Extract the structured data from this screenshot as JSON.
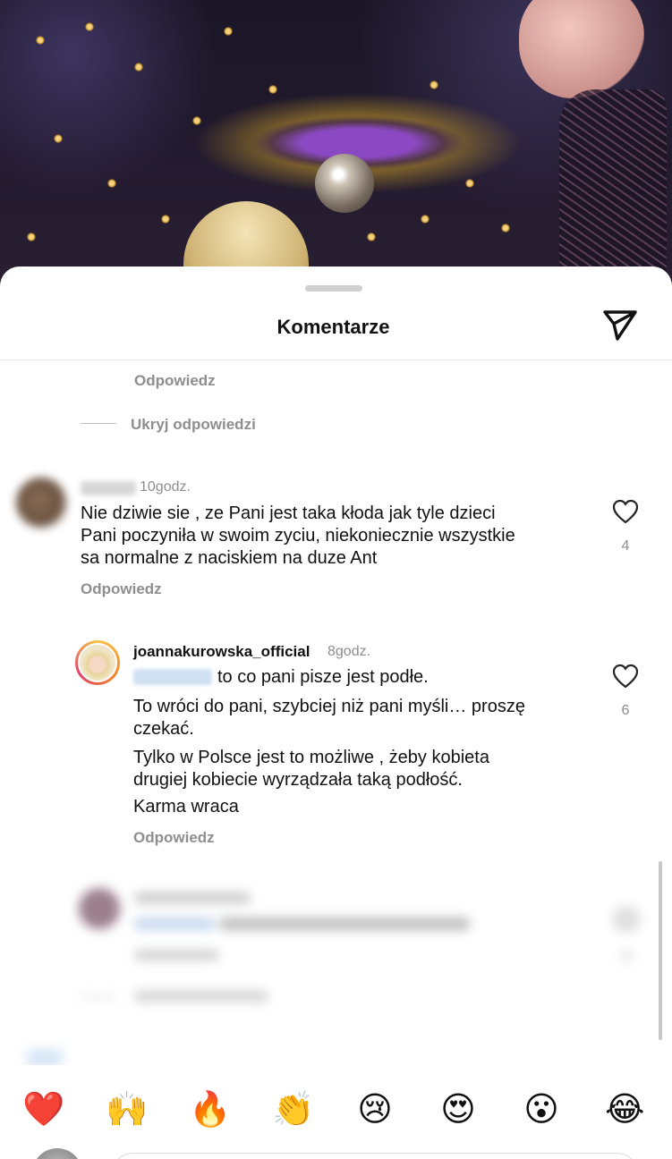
{
  "sheet": {
    "title": "Komentarze"
  },
  "thread_top": {
    "reply_label": "Odpowiedz",
    "hide_replies_label": "Ukryj odpowiedzi"
  },
  "comment1": {
    "time": "10godz.",
    "text_lines": [
      "Nie dziwie sie , ze Pani jest taka kłoda jak tyle dzieci",
      "Pani poczyniła w swoim zyciu, niekoniecznie wszystkie",
      "sa normalne  z naciskiem na duze Ant"
    ],
    "likes": "4",
    "reply_label": "Odpowiedz"
  },
  "reply1": {
    "username": "joannakurowska_official",
    "time": "8godz.",
    "mention_text": "to co pani pisze jest podłe.",
    "paragraph2_lines": [
      "To wróci do pani, szybciej niż pani myśli… proszę",
      "czekać."
    ],
    "paragraph3_lines": [
      "Tylko w Polsce jest to możliwe , żeby kobieta",
      "drugiej kobiecie wyrządzała taką podłość."
    ],
    "paragraph4": "Karma wraca",
    "likes": "6",
    "reply_label": "Odpowiedz"
  },
  "emojis": [
    {
      "name": "heart",
      "glyph": "❤️"
    },
    {
      "name": "raised-hands",
      "glyph": "🙌"
    },
    {
      "name": "fire",
      "glyph": "🔥"
    },
    {
      "name": "clapping-hands",
      "glyph": "👏"
    },
    {
      "name": "crying-face",
      "glyph": "😢"
    },
    {
      "name": "heart-eyes",
      "glyph": "😍"
    },
    {
      "name": "astonished-face",
      "glyph": "😮"
    },
    {
      "name": "tears-of-joy",
      "glyph": "😂"
    }
  ],
  "colors": {
    "text": "#111111",
    "secondary": "#8e8e8e",
    "like": "#262626"
  }
}
